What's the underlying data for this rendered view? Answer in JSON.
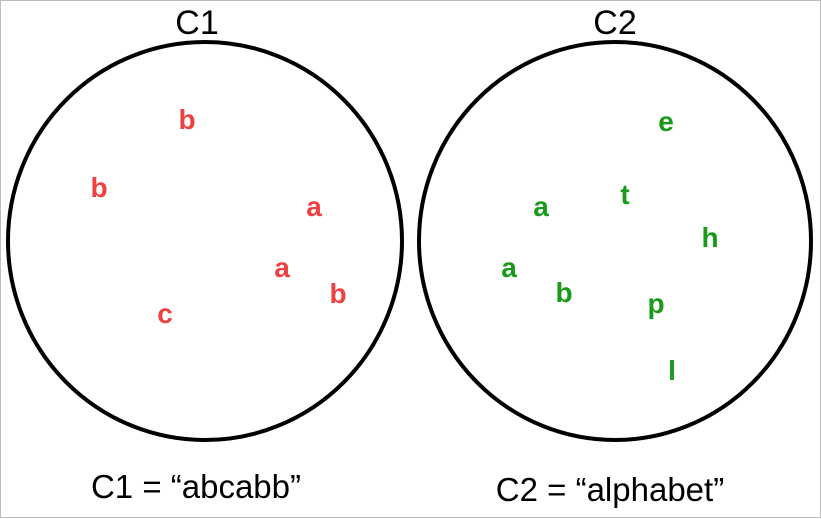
{
  "sets": [
    {
      "id": "c1",
      "title": "C1",
      "caption": "C1 = “abcabb”",
      "color": "#f04040",
      "letters": [
        "b",
        "b",
        "a",
        "a",
        "b",
        "c"
      ]
    },
    {
      "id": "c2",
      "title": "C2",
      "caption": "C2 = “alphabet”",
      "color": "#1a9a1a",
      "letters": [
        "e",
        "a",
        "t",
        "h",
        "a",
        "b",
        "p",
        "l"
      ]
    }
  ]
}
